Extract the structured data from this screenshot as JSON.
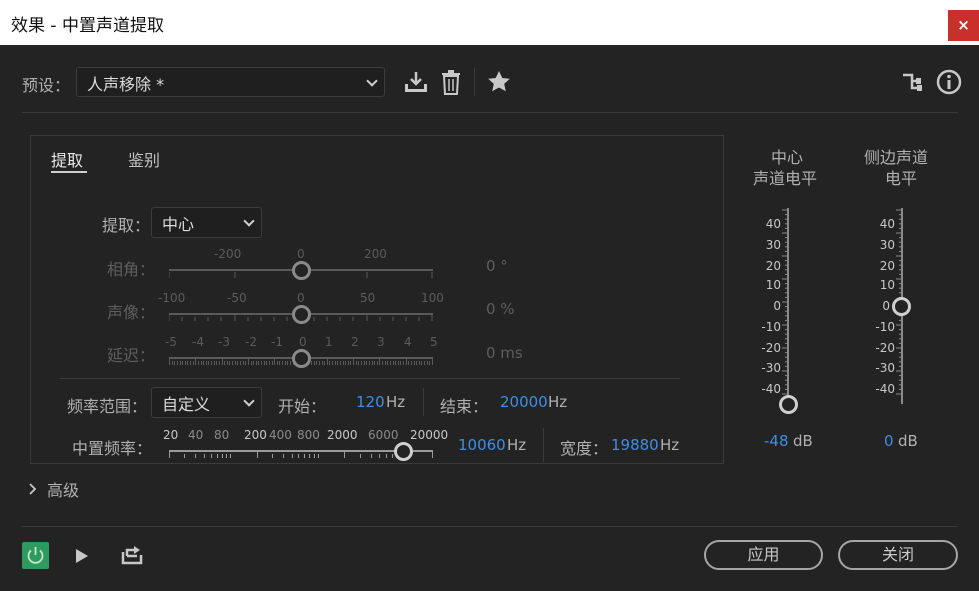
{
  "window": {
    "title": "效果 - 中置声道提取",
    "close": "×"
  },
  "preset": {
    "label": "预设：",
    "value": "人声移除 *"
  },
  "tabs": [
    "提取",
    "鉴别"
  ],
  "extract": {
    "label": "提取：",
    "value": "中心"
  },
  "phase": {
    "label": "相角：",
    "ticks": [
      "-200",
      "0",
      "200"
    ],
    "value": "0 °"
  },
  "pan": {
    "label": "声像：",
    "ticks": [
      "-100",
      "-50",
      "0",
      "50",
      "100"
    ],
    "value": "0 %"
  },
  "delay": {
    "label": "延迟：",
    "ticks": [
      "-5",
      "-4",
      "-3",
      "-2",
      "-1",
      "0",
      "1",
      "2",
      "3",
      "4",
      "5"
    ],
    "value": "0 ms"
  },
  "freq_range": {
    "label": "频率范围：",
    "value": "自定义",
    "start_label": "开始：",
    "start_value": "120",
    "start_unit": "Hz",
    "end_label": "结束：",
    "end_value": "20000",
    "end_unit": "Hz"
  },
  "center_freq": {
    "label": "中置频率：",
    "ticks": [
      "20",
      "40",
      "80",
      "200",
      "400",
      "800",
      "2000",
      "6000",
      "20000"
    ],
    "value": "10060",
    "unit": "Hz",
    "width_label": "宽度：",
    "width_value": "19880",
    "width_unit": "Hz"
  },
  "advanced": {
    "label": "高级"
  },
  "meters": {
    "center": {
      "title1": "中心",
      "title2": "声道电平",
      "ticks": [
        "40",
        "30",
        "20",
        "10",
        "0",
        "-10",
        "-20",
        "-30",
        "-40"
      ],
      "value": "-48",
      "unit": "dB"
    },
    "side": {
      "title1": "侧边声道",
      "title2": "电平",
      "ticks": [
        "40",
        "30",
        "20",
        "10",
        "0",
        "-10",
        "-20",
        "-30",
        "-40"
      ],
      "value": "0",
      "unit": "dB"
    }
  },
  "footer": {
    "apply": "应用",
    "close": "关闭"
  },
  "colors": {
    "accent": "#3f8ee6",
    "power": "#2e9a5e",
    "close": "#c9302c"
  }
}
